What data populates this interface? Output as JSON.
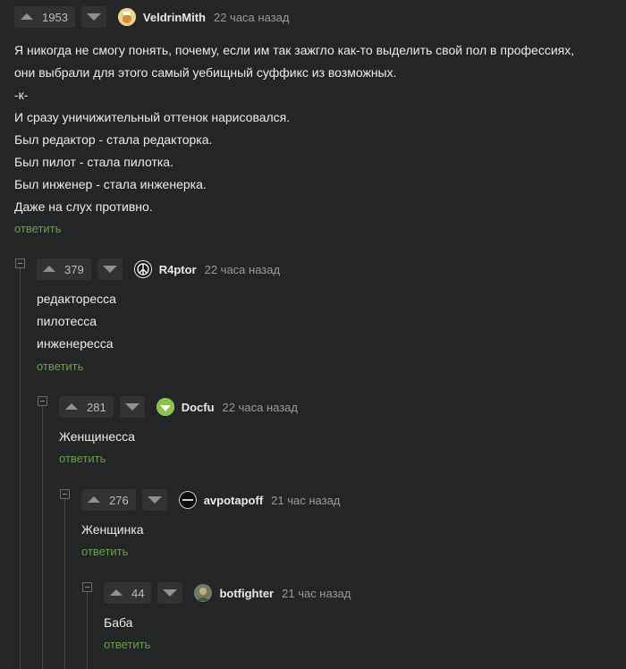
{
  "comments": [
    {
      "votes": "1953",
      "username": "VeldrinMith",
      "time": "22 часа назад",
      "avatar_color": "#e8c36a",
      "lines": [
        "Я никогда не смогу понять, почему, если им так зажгло как-то выделить свой пол в профессиях,",
        "они выбрали для этого самый уебищный суффикс из возможных.",
        "-к-",
        "И сразу уничижительный оттенок нарисовался.",
        "Был редактор - стала редакторка.",
        "Был пилот - стала пилотка.",
        "Был инженер - стала инженерка.",
        "Даже на слух противно."
      ],
      "reply": "ответить"
    },
    {
      "votes": "379",
      "username": "R4ptor",
      "time": "22 часа назад",
      "avatar_color": "#1a1a1a",
      "lines": [
        "редакторесса",
        "пилотесса",
        "инженересса"
      ],
      "reply": "ответить"
    },
    {
      "votes": "281",
      "username": "Docfu",
      "time": "22 часа назад",
      "avatar_color": "#8bc34a",
      "lines": [
        "Женщинесса"
      ],
      "reply": "ответить"
    },
    {
      "votes": "276",
      "username": "avpotapoff",
      "time": "21 час назад",
      "avatar_color": "#111111",
      "lines": [
        "Женщинка"
      ],
      "reply": "ответить"
    },
    {
      "votes": "44",
      "username": "botfighter",
      "time": "21 час назад",
      "avatar_color": "#7a8a6a",
      "lines": [
        "Баба"
      ],
      "reply": "ответить"
    }
  ]
}
